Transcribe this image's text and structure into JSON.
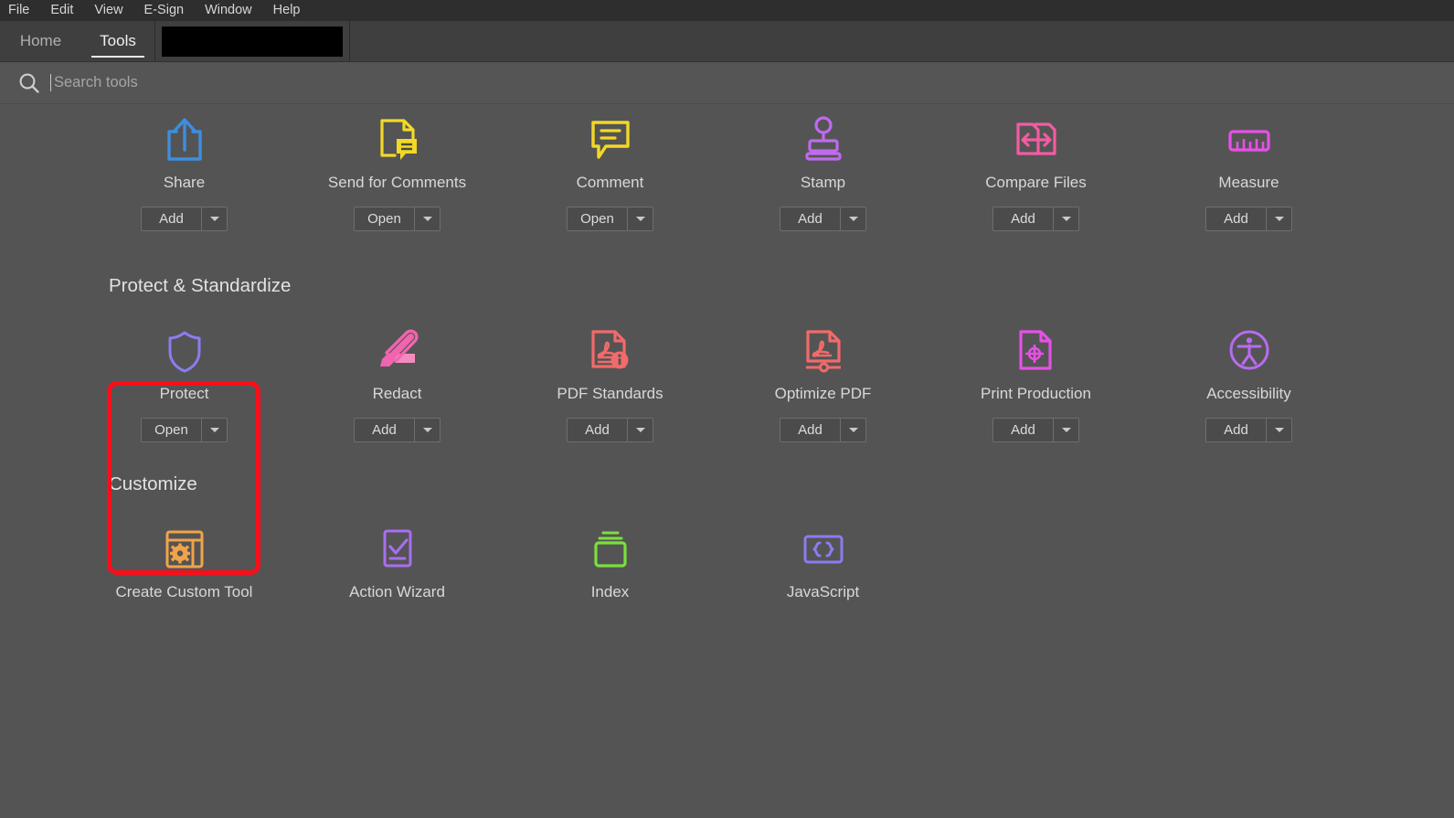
{
  "app": {
    "menubar": [
      "File",
      "Edit",
      "View",
      "E-Sign",
      "Window",
      "Help"
    ],
    "tabs": [
      {
        "label": "Home",
        "active": false
      },
      {
        "label": "Tools",
        "active": true
      }
    ],
    "document_tab": {
      "label": "",
      "redacted": true
    }
  },
  "search": {
    "placeholder": "Search tools",
    "value": "",
    "icon": "search-icon"
  },
  "sections": [
    {
      "title": "",
      "tiles": [
        {
          "label": "Share",
          "icon": "share-icon",
          "color": "#3d8ede",
          "action": "Add"
        },
        {
          "label": "Send for Comments",
          "icon": "send-comments-icon",
          "color": "#f2d827",
          "action": "Open"
        },
        {
          "label": "Comment",
          "icon": "comment-icon",
          "color": "#f2d827",
          "action": "Open"
        },
        {
          "label": "Stamp",
          "icon": "stamp-icon",
          "color": "#bf6af0",
          "action": "Add"
        },
        {
          "label": "Compare Files",
          "icon": "compare-files-icon",
          "color": "#f25ca2",
          "action": "Add"
        },
        {
          "label": "Measure",
          "icon": "measure-icon",
          "color": "#e750e7",
          "action": "Add"
        }
      ]
    },
    {
      "title": "Protect & Standardize",
      "tiles": [
        {
          "label": "Protect",
          "icon": "shield-icon",
          "color": "#8a7df0",
          "action": "Open",
          "highlighted": true
        },
        {
          "label": "Redact",
          "icon": "redact-icon",
          "color": "#f264ae",
          "action": "Add"
        },
        {
          "label": "PDF Standards",
          "icon": "pdf-standards-icon",
          "color": "#f26a6a",
          "action": "Add"
        },
        {
          "label": "Optimize PDF",
          "icon": "optimize-pdf-icon",
          "color": "#f26a6a",
          "action": "Add"
        },
        {
          "label": "Print Production",
          "icon": "print-production-icon",
          "color": "#e750e7",
          "action": "Add"
        },
        {
          "label": "Accessibility",
          "icon": "accessibility-icon",
          "color": "#b munch",
          "action": "Add"
        }
      ]
    },
    {
      "title": "Customize",
      "tiles": [
        {
          "label": "Create Custom Tool",
          "icon": "create-custom-tool-icon",
          "color": "#f0a34a",
          "action": ""
        },
        {
          "label": "Action Wizard",
          "icon": "action-wizard-icon",
          "color": "#a86ef0",
          "action": ""
        },
        {
          "label": "Index",
          "icon": "index-icon",
          "color": "#7ae03c",
          "action": ""
        },
        {
          "label": "JavaScript",
          "icon": "javascript-icon",
          "color": "#8a7df0",
          "action": ""
        }
      ]
    }
  ],
  "buttons": {
    "add": "Add",
    "open": "Open",
    "dropdown_icon": "chevron-down-icon"
  },
  "annotation": {
    "highlight_color": "#fc0d1b",
    "target": "Protect"
  }
}
